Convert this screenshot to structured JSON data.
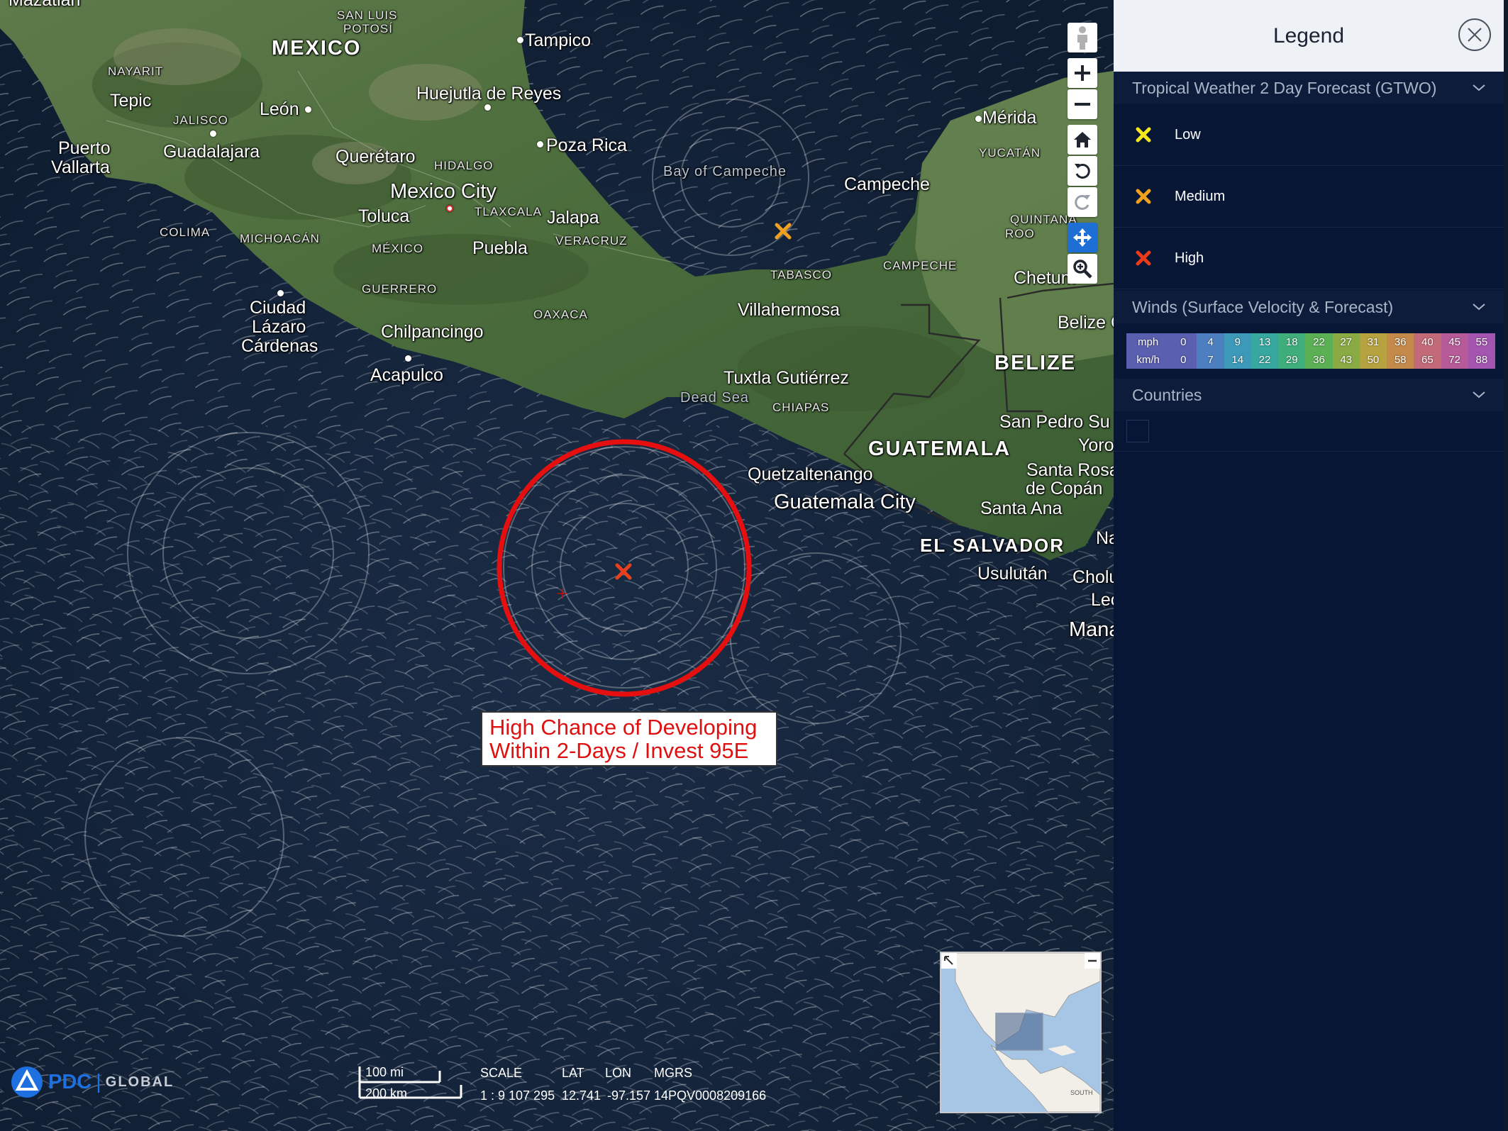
{
  "map": {
    "places": [
      {
        "id": "mazatlan",
        "text": "Mazatlán",
        "cls": "city"
      },
      {
        "id": "mexico",
        "text": "MEXICO",
        "cls": "country"
      },
      {
        "id": "san-luis",
        "text": "SAN LUIS",
        "cls": "state"
      },
      {
        "id": "potosi",
        "text": "POTOSÍ",
        "cls": "state"
      },
      {
        "id": "tampico",
        "text": "Tampico",
        "cls": "city"
      },
      {
        "id": "nayarit",
        "text": "NAYARIT",
        "cls": "state"
      },
      {
        "id": "tepic",
        "text": "Tepic",
        "cls": "city"
      },
      {
        "id": "jalisco",
        "text": "JALISCO",
        "cls": "state"
      },
      {
        "id": "leon",
        "text": "León",
        "cls": "city"
      },
      {
        "id": "huejutla",
        "text": "Huejutla de Reyes",
        "cls": "city"
      },
      {
        "id": "merida",
        "text": "Mérida",
        "cls": "city"
      },
      {
        "id": "yucatan",
        "text": "YUCATÁN",
        "cls": "state"
      },
      {
        "id": "puerto",
        "text": "Puerto",
        "cls": "city"
      },
      {
        "id": "vallarta",
        "text": "Vallarta",
        "cls": "city"
      },
      {
        "id": "guadalajara",
        "text": "Guadalajara",
        "cls": "city"
      },
      {
        "id": "queretaro",
        "text": "Querétaro",
        "cls": "city"
      },
      {
        "id": "hidalgo",
        "text": "HIDALGO",
        "cls": "state"
      },
      {
        "id": "poza-rica",
        "text": "Poza Rica",
        "cls": "city"
      },
      {
        "id": "bay-campeche",
        "text": "Bay of Campeche",
        "cls": "water"
      },
      {
        "id": "campeche-city",
        "text": "Campeche",
        "cls": "city"
      },
      {
        "id": "mexico-city",
        "text": "Mexico City",
        "cls": "bigcity"
      },
      {
        "id": "tlaxcala",
        "text": "TLAXCALA",
        "cls": "state"
      },
      {
        "id": "toluca",
        "text": "Toluca",
        "cls": "city"
      },
      {
        "id": "jalapa",
        "text": "Jalapa",
        "cls": "city"
      },
      {
        "id": "quintana",
        "text": "QUINTANA",
        "cls": "state"
      },
      {
        "id": "roo",
        "text": "ROO",
        "cls": "state"
      },
      {
        "id": "colima",
        "text": "COLIMA",
        "cls": "state"
      },
      {
        "id": "michoacan",
        "text": "MICHOACÁN",
        "cls": "state"
      },
      {
        "id": "mexico-state",
        "text": "MÉXICO",
        "cls": "state"
      },
      {
        "id": "puebla",
        "text": "Puebla",
        "cls": "city"
      },
      {
        "id": "veracruz",
        "text": "VERACRUZ",
        "cls": "state"
      },
      {
        "id": "tabasco",
        "text": "TABASCO",
        "cls": "state"
      },
      {
        "id": "campeche-state",
        "text": "CAMPECHE",
        "cls": "state"
      },
      {
        "id": "chetumal",
        "text": "Chetum",
        "cls": "city"
      },
      {
        "id": "guerrero",
        "text": "GUERRERO",
        "cls": "state"
      },
      {
        "id": "ciudad",
        "text": "Ciudad",
        "cls": "city"
      },
      {
        "id": "lazaro",
        "text": "Lázaro",
        "cls": "city"
      },
      {
        "id": "cardenas",
        "text": "Cárdenas",
        "cls": "city"
      },
      {
        "id": "oaxaca",
        "text": "OAXACA",
        "cls": "state"
      },
      {
        "id": "villahermosa",
        "text": "Villahermosa",
        "cls": "city"
      },
      {
        "id": "belize-city",
        "text": "Belize C",
        "cls": "city"
      },
      {
        "id": "chilpancingo",
        "text": "Chilpancingo",
        "cls": "city"
      },
      {
        "id": "belize",
        "text": "BELIZE",
        "cls": "country"
      },
      {
        "id": "acapulco",
        "text": "Acapulco",
        "cls": "city"
      },
      {
        "id": "tuxtla",
        "text": "Tuxtla Gutiérrez",
        "cls": "city"
      },
      {
        "id": "dead-sea",
        "text": "Dead Sea",
        "cls": "water"
      },
      {
        "id": "chiapas",
        "text": "CHIAPAS",
        "cls": "state"
      },
      {
        "id": "san-pedro",
        "text": "San Pedro Su",
        "cls": "city"
      },
      {
        "id": "guatemala",
        "text": "GUATEMALA",
        "cls": "country"
      },
      {
        "id": "yoro",
        "text": "Yoro",
        "cls": "city"
      },
      {
        "id": "quetzaltenango",
        "text": "Quetzaltenango",
        "cls": "city"
      },
      {
        "id": "santa-rosa",
        "text": "Santa Rosa",
        "cls": "city"
      },
      {
        "id": "de-copan",
        "text": "de Copán",
        "cls": "city"
      },
      {
        "id": "guatemala-city",
        "text": "Guatemala City",
        "cls": "bigcity"
      },
      {
        "id": "santa-ana",
        "text": "Santa Ana",
        "cls": "city"
      },
      {
        "id": "el-salvador",
        "text": "EL SALVADOR",
        "cls": "country"
      },
      {
        "id": "na",
        "text": "Na",
        "cls": "city"
      },
      {
        "id": "usulutan",
        "text": "Usulután",
        "cls": "city"
      },
      {
        "id": "cholu",
        "text": "Cholu",
        "cls": "city"
      },
      {
        "id": "leo",
        "text": "Leo",
        "cls": "city"
      },
      {
        "id": "mana",
        "text": "Mana",
        "cls": "bigcity"
      }
    ],
    "annotation": {
      "line1": "High Chance of Developing",
      "line2": "Within 2-Days / Invest 95E"
    },
    "markers": [
      {
        "id": "medium-marker",
        "level": "Medium",
        "color": "#f0a020"
      },
      {
        "id": "high-marker",
        "level": "High",
        "color": "#e8401c"
      }
    ],
    "circle_color": "#e60f0f"
  },
  "tools": {
    "street_view": "person-icon",
    "zoom_in": "plus-icon",
    "zoom_out": "minus-icon",
    "home": "home-icon",
    "rotate_left": "rotate-left-icon",
    "rotate_right": "rotate-right-icon",
    "pan": "move-icon",
    "zoom_box": "zoom-box-icon"
  },
  "bottom": {
    "logo_pdc": "PDC",
    "logo_sep": "|",
    "logo_global": "GLOBAL",
    "scale_mi": "100 mi",
    "scale_km": "200 km",
    "scale_label": "SCALE",
    "scale_value": "1 : 9 107 295",
    "lat_label": "LAT",
    "lat_value": "12.741",
    "lon_label": "LON",
    "lon_value": "-97.157",
    "mgrs_label": "MGRS",
    "mgrs_value": "14PQV0008209166"
  },
  "minimap": {
    "south_label": "SOUTH"
  },
  "legend": {
    "title": "Legend",
    "sections": {
      "gtwo": {
        "title": "Tropical Weather 2 Day Forecast (GTWO)",
        "items": [
          {
            "label": "Low",
            "color": "#f6e81a"
          },
          {
            "label": "Medium",
            "color": "#f2a11d"
          },
          {
            "label": "High",
            "color": "#ea3a1c"
          }
        ]
      },
      "winds": {
        "title": "Winds (Surface Velocity & Forecast)",
        "units": [
          "mph",
          "km/h"
        ],
        "mph": [
          "0",
          "4",
          "9",
          "13",
          "18",
          "22",
          "27",
          "31",
          "36",
          "40",
          "45",
          "55"
        ],
        "kmh": [
          "0",
          "7",
          "14",
          "22",
          "29",
          "36",
          "43",
          "50",
          "58",
          "65",
          "72",
          "88"
        ],
        "colors": [
          "#5a5fb0",
          "#4d7fc0",
          "#3c9ab8",
          "#37a8a0",
          "#3fae7c",
          "#5cb054",
          "#8aaa44",
          "#b6a23e",
          "#c48a4a",
          "#c36a78",
          "#b75a98",
          "#a455b0"
        ]
      },
      "countries": {
        "title": "Countries"
      }
    }
  }
}
